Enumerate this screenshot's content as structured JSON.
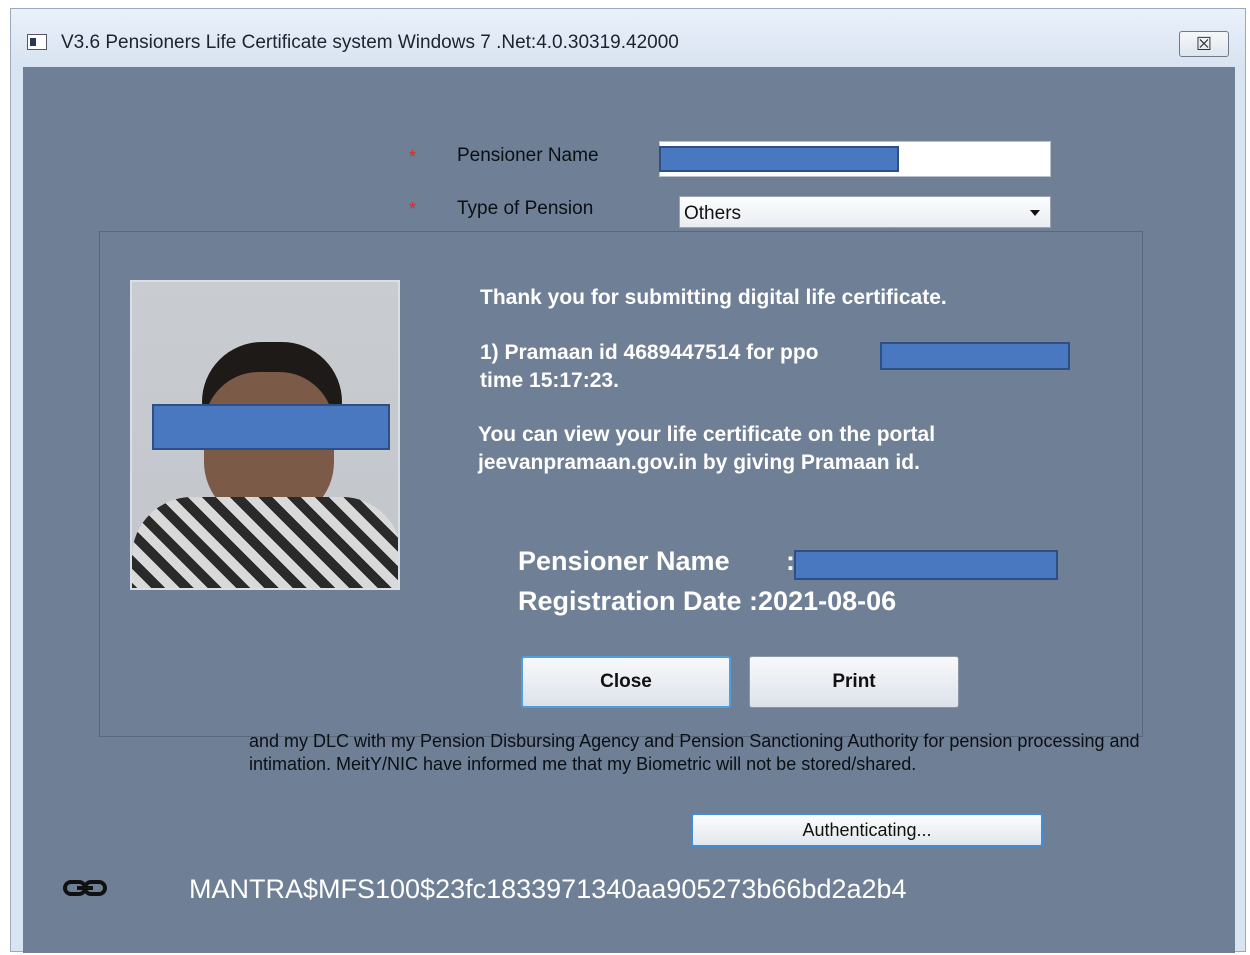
{
  "window": {
    "title": "V3.6 Pensioners Life Certificate system Windows 7 .Net:4.0.30319.42000",
    "close_glyph": "☒"
  },
  "form": {
    "required_mark": "*",
    "pensioner_name_label": "Pensioner Name",
    "type_of_pension_label": "Type of Pension",
    "type_of_pension_value": "Others"
  },
  "dialog": {
    "thank_you": "Thank you for submitting digital life certificate.",
    "pramaan_line": "1) Pramaan id 4689447514 for ppo",
    "time_line": "time 15:17:23.",
    "portal_line1": "You can view your life certificate on the portal",
    "portal_line2": "jeevanpramaan.gov.in by giving Pramaan id.",
    "pensioner_name_label": "Pensioner Name",
    "name_separator": ":",
    "registration_date": "Registration Date :2021-08-06",
    "close_button": "Close",
    "print_button": "Print"
  },
  "consent": {
    "line1": "and my DLC with my Pension Disbursing Agency and Pension Sanctioning Authority for pension processing and",
    "line2": "intimation. MeitY/NIC have informed me that my Biometric will not be stored/shared."
  },
  "authenticating_button": "Authenticating...",
  "device_id": "MANTRA$MFS100$23fc1833971340aa905273b66bd2a2b4",
  "colors": {
    "client_bg": "#6f7f95",
    "redaction": "#4a78c0",
    "required": "#d0322a"
  }
}
